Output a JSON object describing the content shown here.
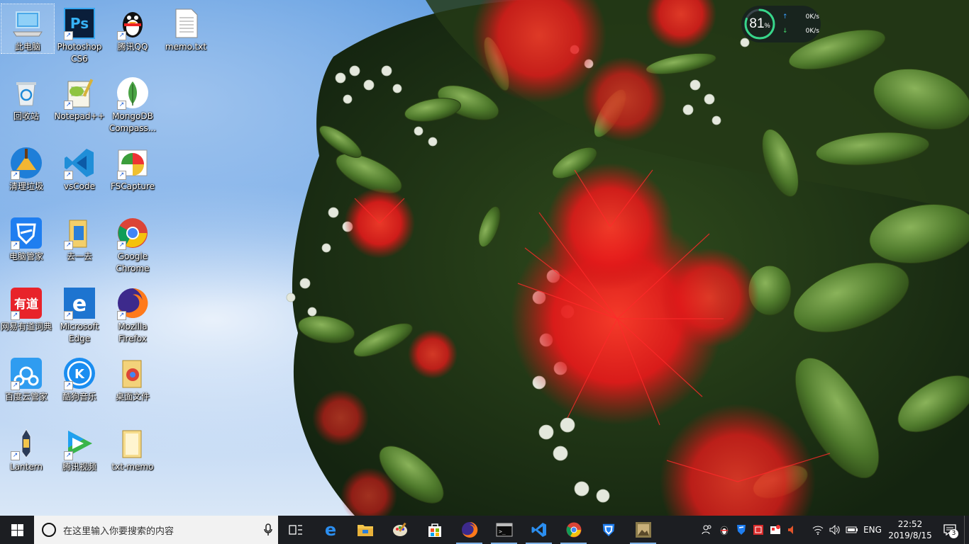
{
  "desktop": {
    "icons": [
      {
        "id": "this-pc",
        "label": "此电脑",
        "icon": "this-pc-icon",
        "shortcut": false
      },
      {
        "id": "photoshop",
        "label": "Photoshop CS6",
        "icon": "photoshop-icon",
        "shortcut": true
      },
      {
        "id": "qq",
        "label": "腾讯QQ",
        "icon": "qq-penguin-icon",
        "shortcut": true
      },
      {
        "id": "memo",
        "label": "memo.txt",
        "icon": "text-file-icon",
        "shortcut": false
      },
      {
        "id": "recycle",
        "label": "回收站",
        "icon": "recycle-bin-icon",
        "shortcut": false
      },
      {
        "id": "notepadpp",
        "label": "Notepad++",
        "icon": "notepad-plus-plus-icon",
        "shortcut": true
      },
      {
        "id": "mongodb",
        "label": "MongoDB Compass...",
        "icon": "mongodb-leaf-icon",
        "shortcut": true
      },
      {
        "id": "cleanup",
        "label": "清理垃圾",
        "icon": "broom-cleanup-icon",
        "shortcut": true
      },
      {
        "id": "vscode",
        "label": "vsCode",
        "icon": "vscode-icon",
        "shortcut": true
      },
      {
        "id": "fscapture",
        "label": "FSCapture",
        "icon": "fscapture-icon",
        "shortcut": true
      },
      {
        "id": "pcmanager",
        "label": "电脑管家",
        "icon": "tencent-pc-manager-icon",
        "shortcut": true
      },
      {
        "id": "quyiqu",
        "label": "去一去",
        "icon": "folder-shortcut-icon",
        "shortcut": true
      },
      {
        "id": "chrome",
        "label": "Google Chrome",
        "icon": "chrome-icon",
        "shortcut": true
      },
      {
        "id": "youdao",
        "label": "网易有道词典",
        "icon": "youdao-dict-icon",
        "shortcut": true
      },
      {
        "id": "edge",
        "label": "Microsoft Edge",
        "icon": "edge-icon",
        "shortcut": true
      },
      {
        "id": "firefox",
        "label": "Mozilla Firefox",
        "icon": "firefox-icon",
        "shortcut": true
      },
      {
        "id": "baiduyun",
        "label": "百度云管家",
        "icon": "baidu-cloud-icon",
        "shortcut": true
      },
      {
        "id": "kugou",
        "label": "酷狗音乐",
        "icon": "kugou-music-icon",
        "shortcut": true
      },
      {
        "id": "deskfiles",
        "label": "桌面文件",
        "icon": "chrome-folder-icon",
        "shortcut": false
      },
      {
        "id": "lantern",
        "label": "Lantern",
        "icon": "lantern-icon",
        "shortcut": true
      },
      {
        "id": "tencentvideo",
        "label": "腾讯视频",
        "icon": "tencent-video-icon",
        "shortcut": true
      },
      {
        "id": "txtmemo",
        "label": "txt-memo",
        "icon": "folder-icon",
        "shortcut": false
      }
    ]
  },
  "widget": {
    "percent": "81",
    "percent_sign": "%",
    "percent_value": 0.81,
    "upload": "0K/s",
    "download": "0K/s",
    "upload_arrow": "↑",
    "download_arrow": "↓"
  },
  "taskbar": {
    "search_placeholder": "在这里输入你要搜索的内容",
    "apps": [
      {
        "name": "task-view-button",
        "icon": "task-view-icon",
        "running": false
      },
      {
        "name": "edge-taskbar-button",
        "icon": "edge-icon",
        "running": false
      },
      {
        "name": "file-explorer-taskbar-button",
        "icon": "folder-icon",
        "running": false
      },
      {
        "name": "paint-taskbar-button",
        "icon": "paint-palette-icon",
        "running": false
      },
      {
        "name": "store-taskbar-button",
        "icon": "store-bag-icon",
        "running": false
      },
      {
        "name": "firefox-taskbar-button",
        "icon": "firefox-icon",
        "running": true
      },
      {
        "name": "terminal-taskbar-button",
        "icon": "terminal-icon",
        "running": true
      },
      {
        "name": "vscode-taskbar-button",
        "icon": "vscode-icon",
        "running": true
      },
      {
        "name": "chrome-taskbar-button",
        "icon": "chrome-icon",
        "running": true
      },
      {
        "name": "pc-manager-taskbar-button",
        "icon": "tencent-pc-manager-icon",
        "running": false
      },
      {
        "name": "image-viewer-taskbar-button",
        "icon": "image-viewer-icon",
        "running": true
      }
    ],
    "tray": {
      "language": "ENG",
      "time": "22:52",
      "date": "2019/8/15",
      "notification_count": "3"
    }
  },
  "colors": {
    "taskbar_bg": "#1c1e22",
    "search_bg": "#f2f2f2",
    "accent": "#0078d7"
  }
}
